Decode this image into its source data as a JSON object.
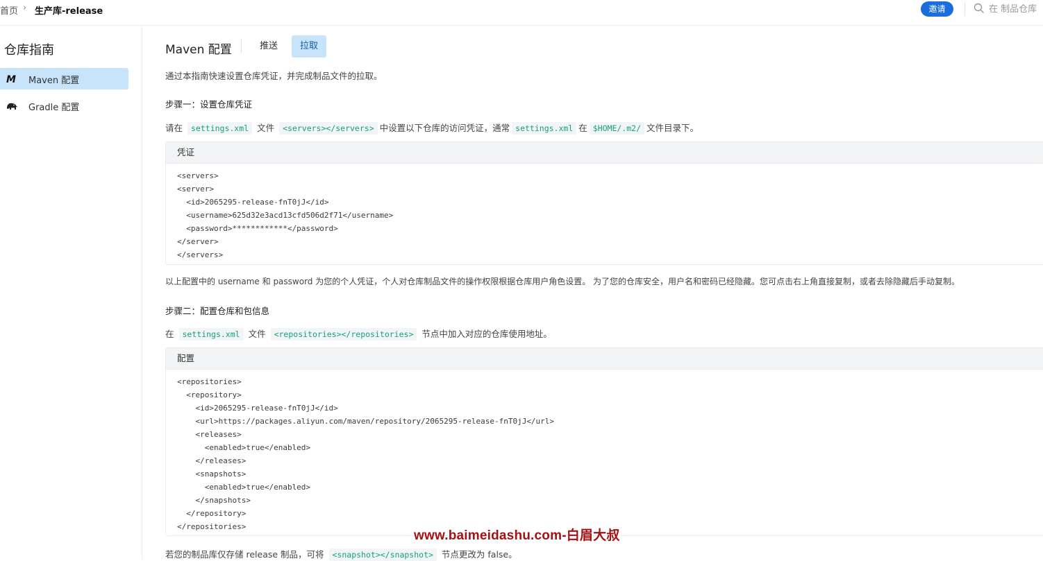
{
  "breadcrumb": {
    "home": "首页",
    "separator": "›",
    "current": "生产库-release"
  },
  "header": {
    "invite_label": "邀请",
    "search_placeholder": "在 制品仓库"
  },
  "sidebar": {
    "title": "仓库指南",
    "items": [
      {
        "label": "Maven 配置",
        "icon": "maven-icon",
        "active": true
      },
      {
        "label": "Gradle 配置",
        "icon": "gradle-elephant-icon",
        "active": false
      }
    ]
  },
  "main": {
    "title": "Maven 配置",
    "tabs": [
      {
        "label": "推送",
        "active": false
      },
      {
        "label": "拉取",
        "active": true
      }
    ],
    "intro": "通过本指南快速设置仓库凭证，并完成制品文件的拉取。",
    "step1": {
      "heading": "步骤一：设置仓库凭证",
      "desc": {
        "t1": "请在",
        "c1": "settings.xml",
        "t2": "文件",
        "c2": "<servers></servers>",
        "t3": "中设置以下仓库的访问凭证，通常",
        "c3": "settings.xml",
        "t4": "在",
        "c4": "$HOME/.m2/",
        "t5": "文件目录下。"
      },
      "block_title": "凭证",
      "code": [
        "<servers>",
        "<server>",
        "  <id>2065295-release-fnT0jJ</id>",
        "  <username>625d32e3acd13cfd506d2f71</username>",
        "  <password>************</password>",
        "</server>",
        "</servers>"
      ],
      "note": "以上配置中的 username 和 password 为您的个人凭证，个人对仓库制品文件的操作权限根据仓库用户角色设置。 为了您的仓库安全，用户名和密码已经隐藏。您可点击右上角直接复制，或者去除隐藏后手动复制。"
    },
    "step2": {
      "heading": "步骤二：配置仓库和包信息",
      "desc": {
        "t1": "在",
        "c1": "settings.xml",
        "t2": "文件",
        "c2": "<repositories></repositories>",
        "t3": "节点中加入对应的仓库使用地址。"
      },
      "block_title": "配置",
      "code": [
        "<repositories>",
        "  <repository>",
        "    <id>2065295-release-fnT0jJ</id>",
        "    <url>https://packages.aliyun.com/maven/repository/2065295-release-fnT0jJ</url>",
        "    <releases>",
        "      <enabled>true</enabled>",
        "    </releases>",
        "    <snapshots>",
        "      <enabled>true</enabled>",
        "    </snapshots>",
        "  </repository>",
        "</repositories>"
      ],
      "footer": {
        "t1": "若您的制品库仅存储 release 制品，可将",
        "c1": "<snapshot></snapshot>",
        "t2": "节点更改为 false。"
      }
    }
  },
  "watermark": "www.baimeidashu.com-白眉大叔",
  "colors": {
    "accent": "#1b6ddc",
    "active_bg": "#c7e4fb",
    "code_green": "#17a274",
    "watermark": "#a21214"
  }
}
